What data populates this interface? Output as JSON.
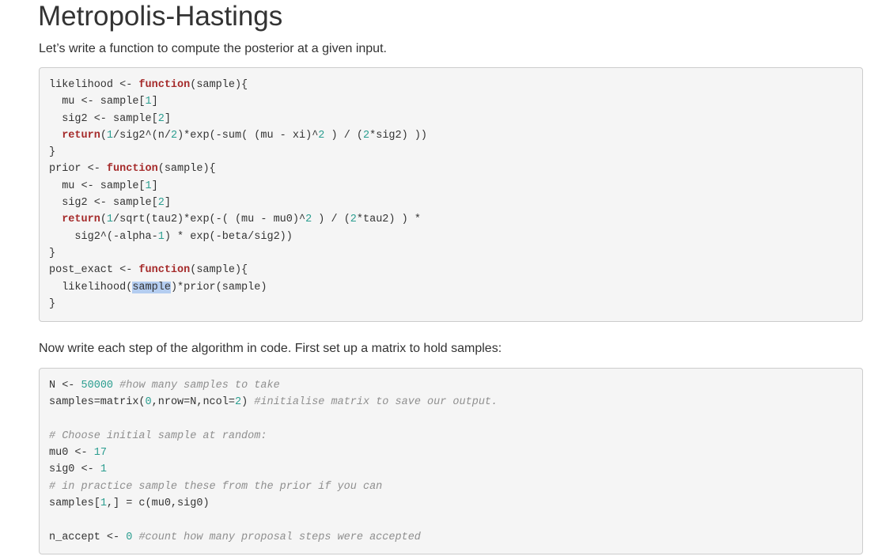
{
  "title": "Metropolis-Hastings",
  "intro_text": "Let’s write a function to compute the posterior at a given input.",
  "step_text": "Now write each step of the algorithm in code. First set up a matrix to hold samples:",
  "code_block_1": {
    "lines": [
      [
        {
          "t": "likelihood <- "
        },
        {
          "t": "function",
          "c": "kw"
        },
        {
          "t": "(sample){"
        }
      ],
      [
        {
          "t": "  mu <- sample["
        },
        {
          "t": "1",
          "c": "num"
        },
        {
          "t": "]"
        }
      ],
      [
        {
          "t": "  sig2 <- sample["
        },
        {
          "t": "2",
          "c": "num"
        },
        {
          "t": "]"
        }
      ],
      [
        {
          "t": "  "
        },
        {
          "t": "return",
          "c": "kw"
        },
        {
          "t": "("
        },
        {
          "t": "1",
          "c": "num"
        },
        {
          "t": "/sig2^(n/"
        },
        {
          "t": "2",
          "c": "num"
        },
        {
          "t": ")*exp(-sum( (mu - xi)^"
        },
        {
          "t": "2",
          "c": "num"
        },
        {
          "t": " ) / ("
        },
        {
          "t": "2",
          "c": "num"
        },
        {
          "t": "*sig2) ))"
        }
      ],
      [
        {
          "t": "}"
        }
      ],
      [
        {
          "t": "prior <- "
        },
        {
          "t": "function",
          "c": "kw"
        },
        {
          "t": "(sample){"
        }
      ],
      [
        {
          "t": "  mu <- sample["
        },
        {
          "t": "1",
          "c": "num"
        },
        {
          "t": "]"
        }
      ],
      [
        {
          "t": "  sig2 <- sample["
        },
        {
          "t": "2",
          "c": "num"
        },
        {
          "t": "]"
        }
      ],
      [
        {
          "t": "  "
        },
        {
          "t": "return",
          "c": "kw"
        },
        {
          "t": "("
        },
        {
          "t": "1",
          "c": "num"
        },
        {
          "t": "/sqrt(tau2)*exp(-( (mu - mu0)^"
        },
        {
          "t": "2",
          "c": "num"
        },
        {
          "t": " ) / ("
        },
        {
          "t": "2",
          "c": "num"
        },
        {
          "t": "*tau2) ) *"
        }
      ],
      [
        {
          "t": "    sig2^(-alpha-"
        },
        {
          "t": "1",
          "c": "num"
        },
        {
          "t": ") * exp(-beta/sig2))"
        }
      ],
      [
        {
          "t": "}"
        }
      ],
      [
        {
          "t": "post_exact <- "
        },
        {
          "t": "function",
          "c": "kw"
        },
        {
          "t": "(sample){"
        }
      ],
      [
        {
          "t": "  likelihood("
        },
        {
          "t": "sample",
          "c": "sel"
        },
        {
          "t": ")*prior(sample)"
        }
      ],
      [
        {
          "t": "}"
        }
      ]
    ]
  },
  "code_block_2": {
    "lines": [
      [
        {
          "t": "N <- "
        },
        {
          "t": "50000",
          "c": "num"
        },
        {
          "t": " "
        },
        {
          "t": "#how many samples to take",
          "c": "cm"
        }
      ],
      [
        {
          "t": "samples=matrix("
        },
        {
          "t": "0",
          "c": "num"
        },
        {
          "t": ",nrow=N,ncol="
        },
        {
          "t": "2",
          "c": "num"
        },
        {
          "t": ") "
        },
        {
          "t": "#initialise matrix to save our output.",
          "c": "cm"
        }
      ],
      [
        {
          "t": ""
        }
      ],
      [
        {
          "t": "# Choose initial sample at random:",
          "c": "cm"
        }
      ],
      [
        {
          "t": "mu0 <- "
        },
        {
          "t": "17",
          "c": "num"
        }
      ],
      [
        {
          "t": "sig0 <- "
        },
        {
          "t": "1",
          "c": "num"
        }
      ],
      [
        {
          "t": "# in practice sample these from the prior if you can",
          "c": "cm"
        }
      ],
      [
        {
          "t": "samples["
        },
        {
          "t": "1",
          "c": "num"
        },
        {
          "t": ",] = c(mu0,sig0)"
        }
      ],
      [
        {
          "t": ""
        }
      ],
      [
        {
          "t": "n_accept <- "
        },
        {
          "t": "0",
          "c": "num"
        },
        {
          "t": " "
        },
        {
          "t": "#count how many proposal steps were accepted",
          "c": "cm"
        }
      ]
    ]
  }
}
